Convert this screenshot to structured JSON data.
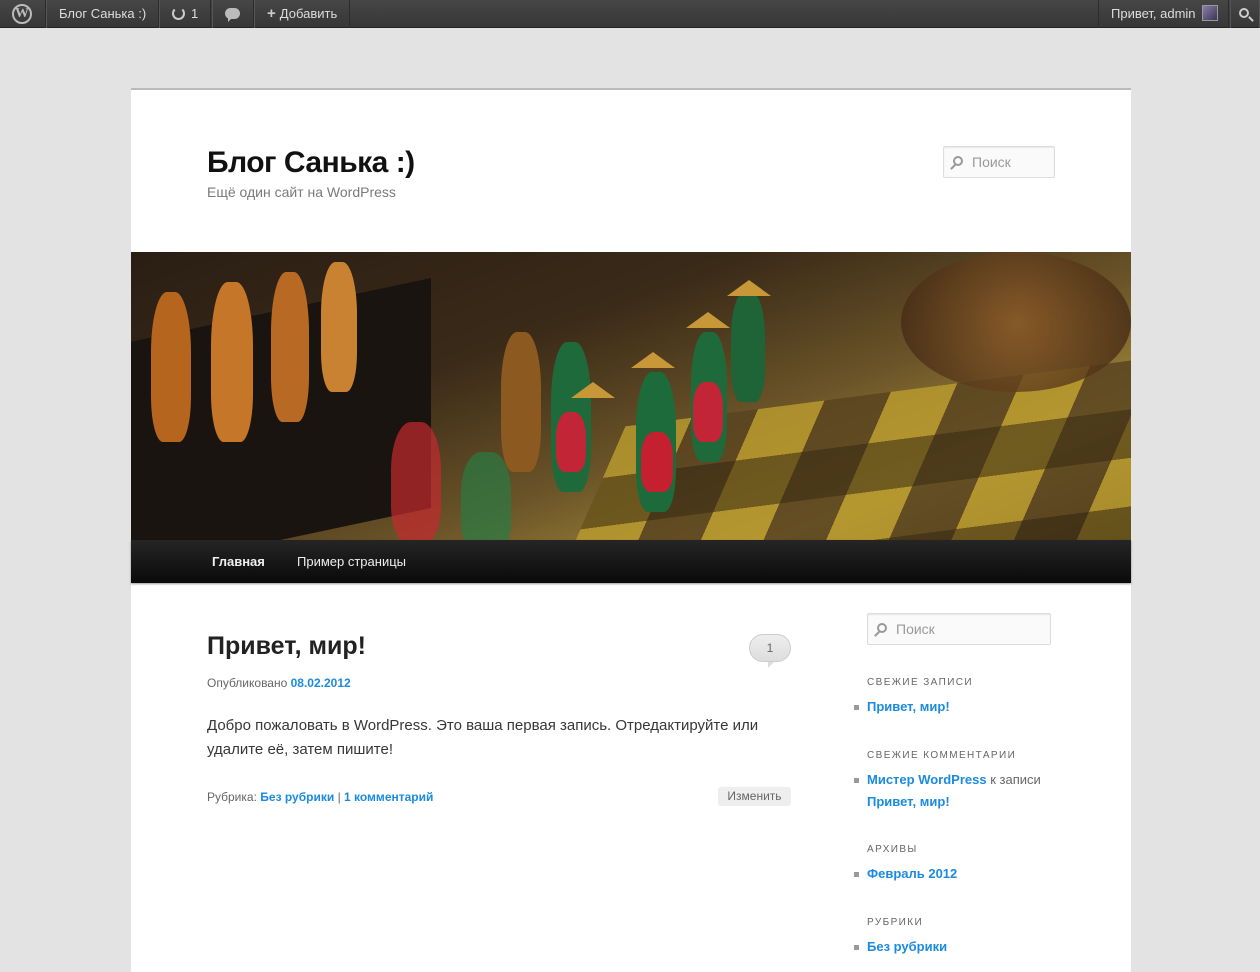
{
  "admin_bar": {
    "site_name": "Блог Санька :)",
    "updates_count": "1",
    "new_label": "Добавить",
    "greeting": "Привет, admin"
  },
  "site": {
    "title": "Блог Санька :)",
    "description": "Ещё один сайт на WordPress",
    "search_placeholder": "Поиск"
  },
  "nav": {
    "items": [
      {
        "label": "Главная"
      },
      {
        "label": "Пример страницы"
      }
    ]
  },
  "post": {
    "title": "Привет, мир!",
    "comments_count": "1",
    "published_prefix": "Опубликовано",
    "published_date": "08.02.2012",
    "content": "Добро пожаловать в WordPress. Это ваша первая запись. Отредактируйте или удалите её, затем пишите!",
    "category_prefix": "Рубрика:",
    "category": "Без рубрики",
    "separator": "|",
    "comments_link": "1 комментарий",
    "edit_label": "Изменить"
  },
  "sidebar": {
    "search_placeholder": "Поиск",
    "recent_posts_title": "Свежие записи",
    "recent_posts": [
      "Привет, мир!"
    ],
    "recent_comments_title": "Свежие комментарии",
    "recent_comment": {
      "author": "Мистер WordPress",
      "connector": "к записи",
      "post": "Привет, мир!"
    },
    "archives_title": "Архивы",
    "archives": [
      "Февраль 2012"
    ],
    "categories_title": "Рубрики",
    "categories": [
      "Без рубрики"
    ]
  },
  "colors": {
    "link": "#1b8be0",
    "admin_bar": "#464646",
    "nav_bar": "#252525"
  }
}
